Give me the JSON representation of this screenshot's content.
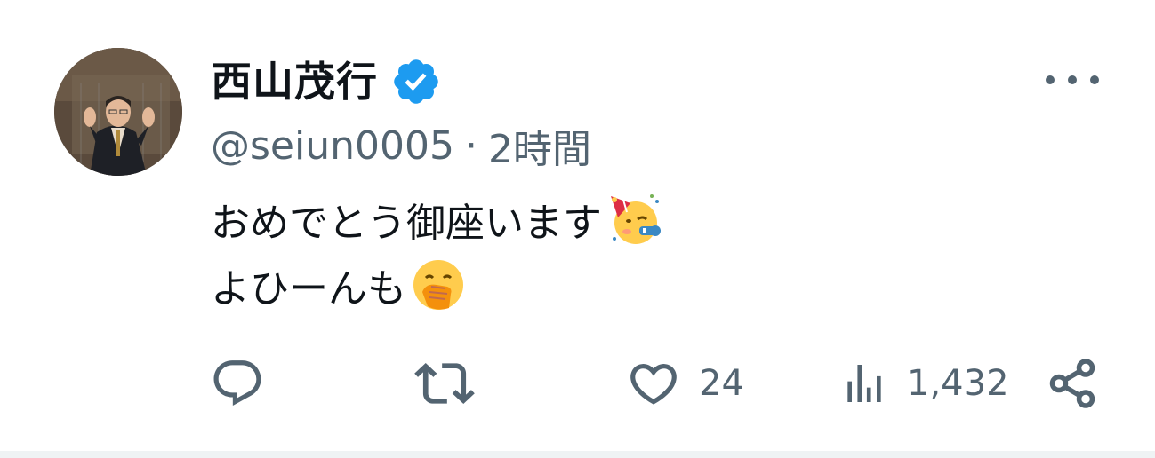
{
  "author": {
    "display_name": "西山茂行",
    "handle": "@seiun0005",
    "separator": "·",
    "time_ago": "2時間",
    "verified": true,
    "verified_color": "#1d9bf0"
  },
  "tweet": {
    "line1": "おめでとう御座います",
    "line2": "よひーんも",
    "emojis": [
      "partying-face",
      "face-with-hand-over-mouth"
    ]
  },
  "actions": {
    "reply_count": "",
    "retweet_count": "",
    "like_count": "24",
    "view_count": "1,432"
  },
  "colors": {
    "text_primary": "#0f1419",
    "text_secondary": "#536471",
    "border": "#eff3f4"
  },
  "icons": {
    "more": "more-horizontal-icon",
    "reply": "reply-icon",
    "retweet": "retweet-icon",
    "like": "heart-icon",
    "views": "views-bar-chart-icon",
    "share": "share-icon"
  }
}
